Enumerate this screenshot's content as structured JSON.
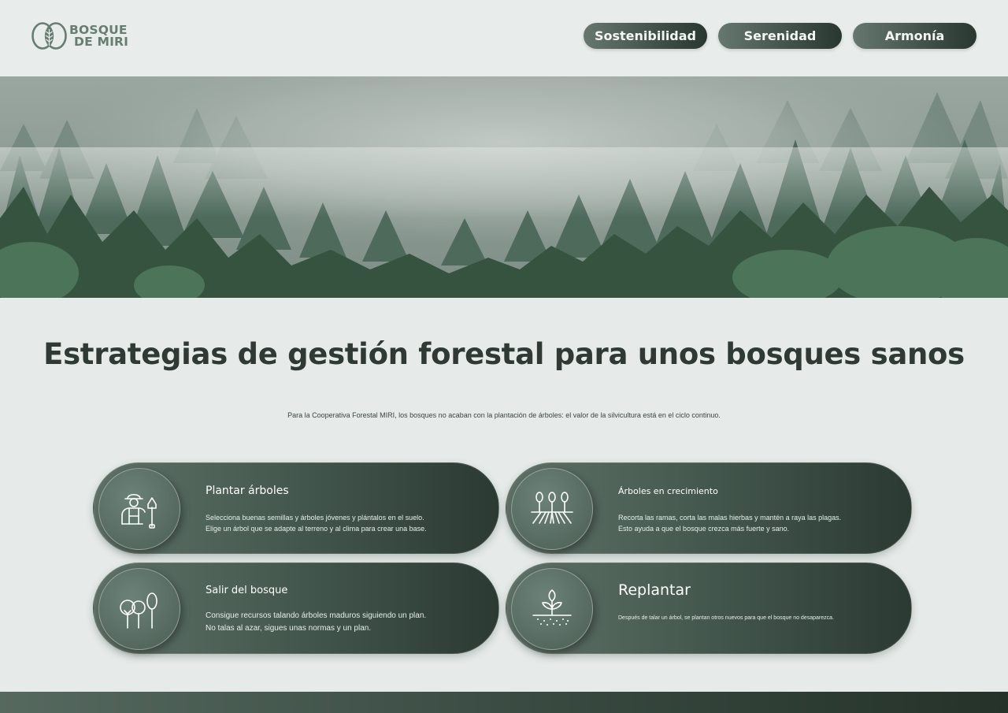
{
  "brand": {
    "name_line1": "BOSQUE",
    "name_line2": "DE MIRI",
    "color": "#667d72"
  },
  "nav": {
    "items": [
      {
        "label": "Sostenibilidad"
      },
      {
        "label": "Serenidad"
      },
      {
        "label": "Armonía"
      }
    ]
  },
  "hero": {
    "image": "misty-pine-forest"
  },
  "main": {
    "title": "Estrategias de gestión forestal para unos bosques sanos",
    "subtitle": "Para la Cooperativa Forestal MIRI, los bosques no acaban con la plantación de árboles: el valor de la silvicultura está en el ciclo continuo."
  },
  "cards": [
    {
      "icon": "farmer-with-shovel-icon",
      "title": "Plantar árboles",
      "line1": "Selecciona buenas semillas y árboles jóvenes y plántalos en el suelo.",
      "line2": "Elige un árbol que se adapte al terreno y al clima para crear una base."
    },
    {
      "icon": "growing-trees-icon",
      "title": "Árboles en crecimiento",
      "line1": "Recorta las ramas, corta las malas hierbas y mantén a raya las plagas.",
      "line2": " Esto ayuda a que el bosque crezca más fuerte y sano."
    },
    {
      "icon": "trees-icon",
      "title": "Salir del bosque",
      "line1": "Consigue recursos talando árboles maduros siguiendo un plan.",
      "line2": " No talas al azar, sigues unas normas y un plan."
    },
    {
      "icon": "sprout-icon",
      "title": "Replantar",
      "line1": "Después de talar un árbol, se plantan otros nuevos para que el bosque no desaparezca."
    }
  ],
  "colors": {
    "background": "#e6ebe9",
    "accent_dark": "#2b3a33",
    "accent_light": "#66776f"
  }
}
